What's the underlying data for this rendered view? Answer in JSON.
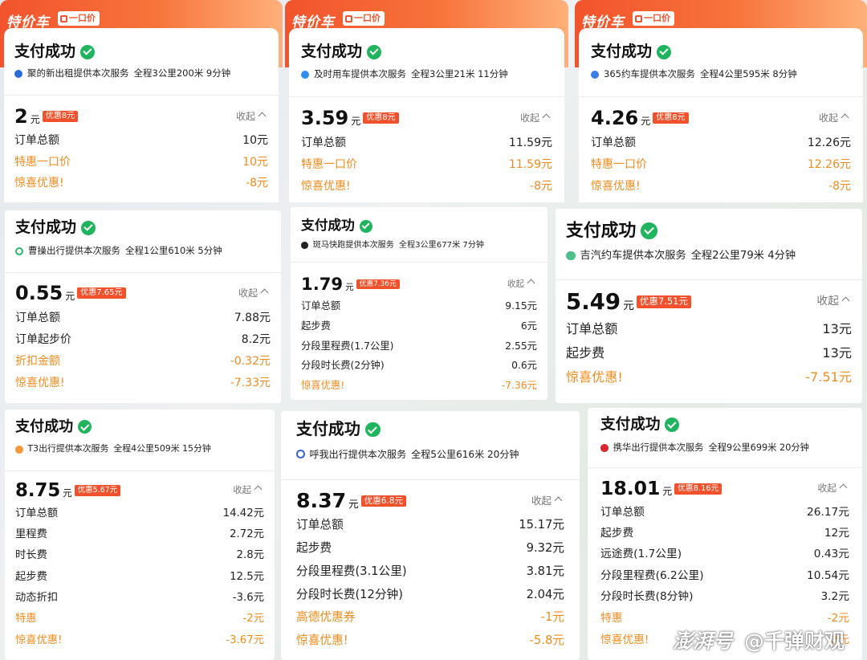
{
  "colors": {
    "accent_orange": "#f08c1e",
    "badge_red": "#f2512b",
    "check_green": "#21b45f",
    "banner": "#f2532c"
  },
  "banner": {
    "brand": "特价车",
    "price_tag": "一口价"
  },
  "collapse_label": "收起",
  "cards": [
    {
      "title": "支付成功",
      "provider": "聚的新出租提供本次服务",
      "trip": "全程3公里200米 9分钟",
      "provider_icon": "blue-pill-icon",
      "provider_color": "#2a6cd6",
      "amount": "2",
      "unit": "元",
      "discount_badge": "优惠8元",
      "rows": [
        {
          "label": "订单总额",
          "value": "10元",
          "style": "dark"
        },
        {
          "label": "特惠一口价",
          "value": "10元",
          "style": "orange"
        },
        {
          "label": "惊喜优惠!",
          "value": "-8元",
          "style": "orange"
        }
      ]
    },
    {
      "title": "支付成功",
      "provider": "及时用车提供本次服务",
      "trip": "全程3公里21米 11分钟",
      "provider_icon": "blue-circle-icon",
      "provider_color": "#2f8ff0",
      "amount": "3.59",
      "unit": "元",
      "discount_badge": "优惠8元",
      "rows": [
        {
          "label": "订单总额",
          "value": "11.59元",
          "style": "dark"
        },
        {
          "label": "特惠一口价",
          "value": "11.59元",
          "style": "orange"
        },
        {
          "label": "惊喜优惠!",
          "value": "-8元",
          "style": "orange"
        }
      ]
    },
    {
      "title": "支付成功",
      "provider": "365约车提供本次服务",
      "trip": "全程4公里595米 8分钟",
      "provider_icon": "blue-circle-icon",
      "provider_color": "#3b7be8",
      "amount": "4.26",
      "unit": "元",
      "discount_badge": "优惠8元",
      "rows": [
        {
          "label": "订单总额",
          "value": "12.26元",
          "style": "dark"
        },
        {
          "label": "特惠一口价",
          "value": "12.26元",
          "style": "orange"
        },
        {
          "label": "惊喜优惠!",
          "value": "-8元",
          "style": "orange"
        }
      ]
    },
    {
      "title": "支付成功",
      "provider": "曹操出行提供本次服务",
      "trip": "全程1公里610米 5分钟",
      "provider_icon": "green-c-icon",
      "provider_color": "#2fb36a",
      "amount": "0.55",
      "unit": "元",
      "discount_badge": "优惠7.65元",
      "rows": [
        {
          "label": "订单总额",
          "value": "7.88元",
          "style": "dark"
        },
        {
          "label": "订单起步价",
          "value": "8.2元",
          "style": "dark"
        },
        {
          "label": "折扣金额",
          "value": "-0.32元",
          "style": "orange"
        },
        {
          "label": "惊喜优惠!",
          "value": "-7.33元",
          "style": "orange"
        }
      ]
    },
    {
      "title": "支付成功",
      "provider": "斑马快跑提供本次服务",
      "trip": "全程3公里677米 7分钟",
      "provider_icon": "black-circle-icon",
      "provider_color": "#222222",
      "amount": "1.79",
      "unit": "元",
      "discount_badge": "优惠7.36元",
      "rows": [
        {
          "label": "订单总额",
          "value": "9.15元",
          "style": "dark"
        },
        {
          "label": "起步费",
          "value": "6元",
          "style": "dark"
        },
        {
          "label": "分段里程费(1.7公里)",
          "value": "2.55元",
          "style": "dark"
        },
        {
          "label": "分段时长费(2分钟)",
          "value": "0.6元",
          "style": "dark"
        },
        {
          "label": "惊喜优惠!",
          "value": "-7.36元",
          "style": "orange"
        }
      ]
    },
    {
      "title": "支付成功",
      "provider": "吉汽约车提供本次服务",
      "trip": "全程2公里79米 4分钟",
      "provider_icon": "green-shield-icon",
      "provider_color": "#4fbf8a",
      "amount": "5.49",
      "unit": "元",
      "discount_badge": "优惠7.51元",
      "rows": [
        {
          "label": "订单总额",
          "value": "13元",
          "style": "dark"
        },
        {
          "label": "起步费",
          "value": "13元",
          "style": "dark"
        },
        {
          "label": "惊喜优惠!",
          "value": "-7.51元",
          "style": "orange"
        }
      ]
    },
    {
      "title": "支付成功",
      "provider": "T3出行提供本次服务",
      "trip": "全程4公里509米 15分钟",
      "provider_icon": "orange-flower-icon",
      "provider_color": "#f29a3a",
      "amount": "8.75",
      "unit": "元",
      "discount_badge": "优惠5.67元",
      "rows": [
        {
          "label": "订单总额",
          "value": "14.42元",
          "style": "dark"
        },
        {
          "label": "里程费",
          "value": "2.72元",
          "style": "dark"
        },
        {
          "label": "时长费",
          "value": "2.8元",
          "style": "dark"
        },
        {
          "label": "起步费",
          "value": "12.5元",
          "style": "dark"
        },
        {
          "label": "动态折扣",
          "value": "-3.6元",
          "style": "dark"
        },
        {
          "label": "特惠",
          "value": "-2元",
          "style": "orange"
        },
        {
          "label": "惊喜优惠!",
          "value": "-3.67元",
          "style": "orange"
        }
      ]
    },
    {
      "title": "支付成功",
      "provider": "呼我出行提供本次服务",
      "trip": "全程5公里616米 20分钟",
      "provider_icon": "blue-ring-icon",
      "provider_color": "#3266d6",
      "amount": "8.37",
      "unit": "元",
      "discount_badge": "优惠6.8元",
      "rows": [
        {
          "label": "订单总额",
          "value": "15.17元",
          "style": "dark"
        },
        {
          "label": "起步费",
          "value": "9.32元",
          "style": "dark"
        },
        {
          "label": "分段里程费(3.1公里)",
          "value": "3.81元",
          "style": "dark"
        },
        {
          "label": "分段时长费(12分钟)",
          "value": "2.04元",
          "style": "dark"
        },
        {
          "label": "高德优惠券",
          "value": "-1元",
          "style": "orange"
        },
        {
          "label": "惊喜优惠!",
          "value": "-5.8元",
          "style": "orange"
        }
      ]
    },
    {
      "title": "支付成功",
      "provider": "携华出行提供本次服务",
      "trip": "全程9公里699米 20分钟",
      "provider_icon": "red-circle-icon",
      "provider_color": "#d9262f",
      "amount": "18.01",
      "unit": "元",
      "discount_badge": "优惠8.16元",
      "rows": [
        {
          "label": "订单总额",
          "value": "26.17元",
          "style": "dark"
        },
        {
          "label": "起步费",
          "value": "12元",
          "style": "dark"
        },
        {
          "label": "远途费(1.7公里)",
          "value": "0.43元",
          "style": "dark"
        },
        {
          "label": "分段里程费(6.2公里)",
          "value": "10.54元",
          "style": "dark"
        },
        {
          "label": "分段时长费(8分钟)",
          "value": "3.2元",
          "style": "dark"
        },
        {
          "label": "特惠",
          "value": "-2元",
          "style": "orange"
        },
        {
          "label": "惊喜优惠!",
          "value": "-2元",
          "style": "orange"
        }
      ]
    }
  ],
  "watermark": {
    "brand": "澎湃号",
    "author": "@千弹财观"
  }
}
